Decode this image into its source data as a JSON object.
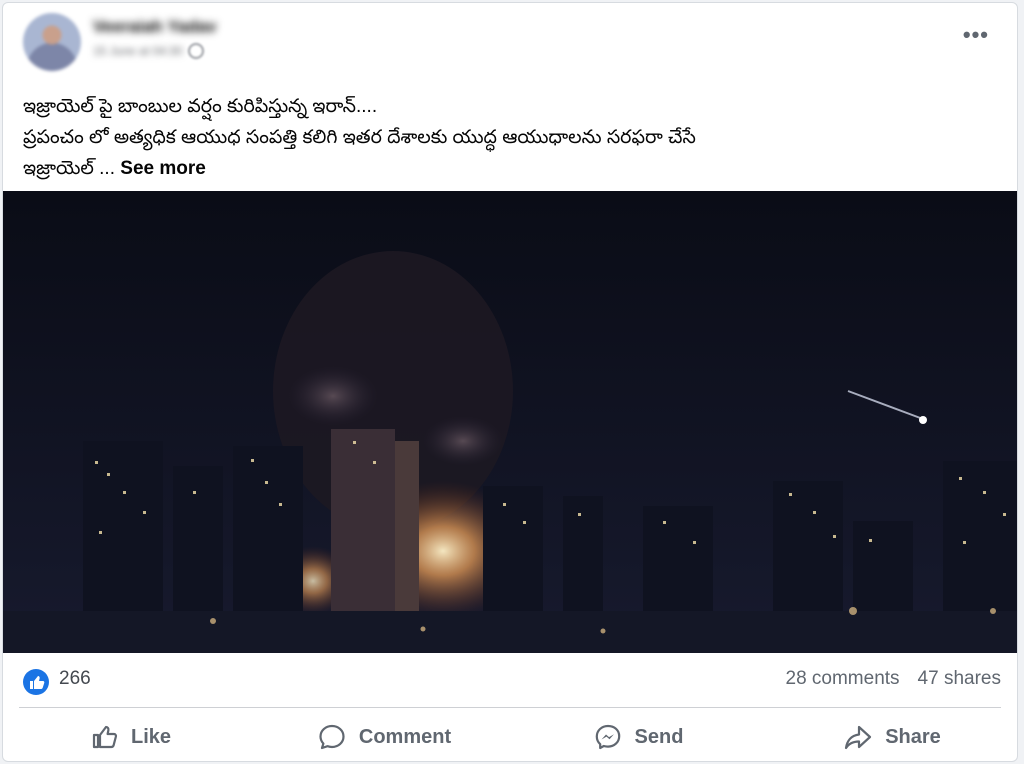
{
  "post": {
    "author": "Veeraiah Yadav",
    "timestamp": "15 June at 04:30",
    "lines": [
      "ఇజ్రాయెల్ పై బాంబుల వర్షం కురిపిస్తున్న ఇరాన్....",
      "ప్రపంచం లో అత్యధిక ఆయుధ సంపత్తి కలిగి ఇతర దేశాలకు యుద్ధ ఆయుధాలను సరఫరా చేసే",
      "ఇజ్రాయెల్ ..."
    ],
    "see_more": "See more",
    "more_icon": "•••"
  },
  "stats": {
    "reactions": "266",
    "comments": "28 comments",
    "shares": "47 shares"
  },
  "actions": {
    "like": "Like",
    "comment": "Comment",
    "send": "Send",
    "share": "Share"
  },
  "colors": {
    "accent": "#1b74e4",
    "text": "#050505",
    "muted": "#606770"
  },
  "icons": [
    "thumbs-up-icon",
    "comment-bubble-icon",
    "messenger-send-icon",
    "share-arrow-icon",
    "more-options-icon",
    "globe-icon"
  ]
}
